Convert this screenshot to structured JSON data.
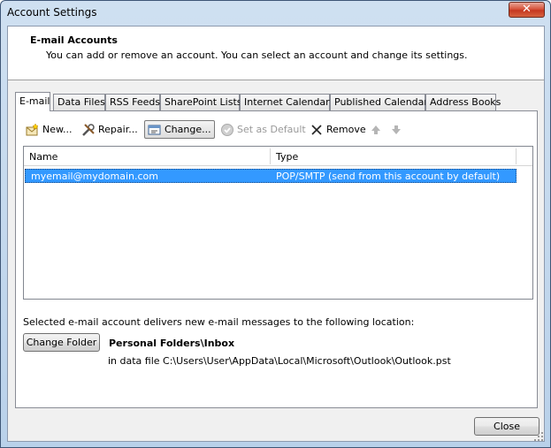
{
  "window": {
    "title": "Account Settings",
    "close_glyph": "✕"
  },
  "header": {
    "title": "E-mail Accounts",
    "description": "You can add or remove an account. You can select an account and change its settings."
  },
  "tabs": [
    {
      "label": "E-mail",
      "active": true
    },
    {
      "label": "Data Files"
    },
    {
      "label": "RSS Feeds"
    },
    {
      "label": "SharePoint Lists"
    },
    {
      "label": "Internet Calendars"
    },
    {
      "label": "Published Calendars"
    },
    {
      "label": "Address Books"
    }
  ],
  "toolbar": {
    "new_label": "New...",
    "repair_label": "Repair...",
    "change_label": "Change...",
    "set_default_label": "Set as Default",
    "remove_label": "Remove"
  },
  "accounts_list": {
    "columns": [
      "Name",
      "Type"
    ],
    "rows": [
      {
        "name": "myemail@mydomain.com",
        "type": "POP/SMTP (send from this account by default)",
        "selected": true
      }
    ]
  },
  "delivery": {
    "description": "Selected e-mail account delivers new e-mail messages to the following location:",
    "change_folder_label": "Change Folder",
    "folder": "Personal Folders\\Inbox",
    "data_file": "in data file C:\\Users\\User\\AppData\\Local\\Microsoft\\Outlook\\Outlook.pst"
  },
  "footer": {
    "close_label": "Close"
  },
  "colors": {
    "selection": "#3399ff",
    "title_close": "#c53820",
    "frame": "#b9d1ea"
  }
}
